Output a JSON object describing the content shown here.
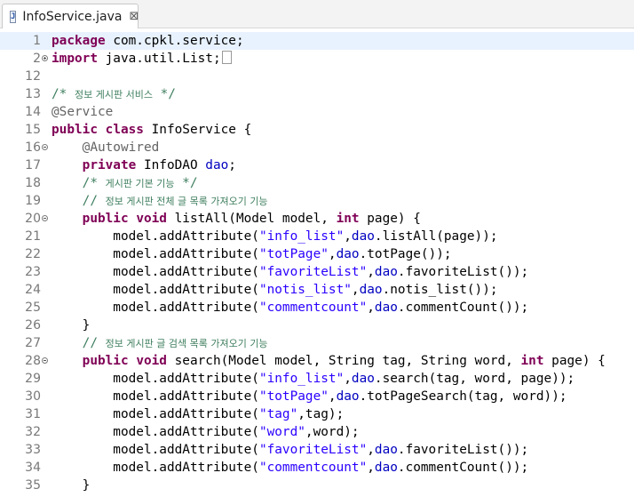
{
  "tab": {
    "icon": "java-file-icon",
    "title": "InfoService.java",
    "close": "⊠"
  },
  "lines": [
    {
      "n": "1",
      "fold": "",
      "current": true,
      "tokens": [
        {
          "t": "package",
          "c": "kw"
        },
        {
          "t": " com.cpkl.service;",
          "c": ""
        }
      ]
    },
    {
      "n": "2",
      "fold": "plus",
      "current": false,
      "tokens": [
        {
          "t": "import",
          "c": "kw"
        },
        {
          "t": " java.util.List;",
          "c": ""
        },
        {
          "t": "",
          "c": "box"
        }
      ]
    },
    {
      "n": "12",
      "fold": "",
      "current": false,
      "tokens": []
    },
    {
      "n": "13",
      "fold": "",
      "current": false,
      "tokens": [
        {
          "t": "/* ",
          "c": "cmt"
        },
        {
          "t": "정보 게시판 서비스",
          "c": "cmt kor"
        },
        {
          "t": " */",
          "c": "cmt"
        }
      ]
    },
    {
      "n": "14",
      "fold": "",
      "current": false,
      "tokens": [
        {
          "t": "@Service",
          "c": "ann"
        }
      ]
    },
    {
      "n": "15",
      "fold": "",
      "current": false,
      "tokens": [
        {
          "t": "public",
          "c": "kw"
        },
        {
          "t": " ",
          "c": ""
        },
        {
          "t": "class",
          "c": "kw"
        },
        {
          "t": " InfoService {",
          "c": ""
        }
      ]
    },
    {
      "n": "16",
      "fold": "minus",
      "current": false,
      "tokens": [
        {
          "t": "    @Autowired",
          "c": "ann"
        }
      ]
    },
    {
      "n": "17",
      "fold": "",
      "current": false,
      "tokens": [
        {
          "t": "    ",
          "c": ""
        },
        {
          "t": "private",
          "c": "kw"
        },
        {
          "t": " InfoDAO ",
          "c": ""
        },
        {
          "t": "dao",
          "c": "fld"
        },
        {
          "t": ";",
          "c": ""
        }
      ]
    },
    {
      "n": "18",
      "fold": "",
      "current": false,
      "tokens": [
        {
          "t": "    /* ",
          "c": "cmt"
        },
        {
          "t": "게시판 기본 기능",
          "c": "cmt kor"
        },
        {
          "t": " */",
          "c": "cmt"
        }
      ]
    },
    {
      "n": "19",
      "fold": "",
      "current": false,
      "tokens": [
        {
          "t": "    // ",
          "c": "cmt"
        },
        {
          "t": "정보 게시판 전체 글 목록 가져오기 기능",
          "c": "cmt kor"
        }
      ]
    },
    {
      "n": "20",
      "fold": "minus",
      "current": false,
      "tokens": [
        {
          "t": "    ",
          "c": ""
        },
        {
          "t": "public",
          "c": "kw"
        },
        {
          "t": " ",
          "c": ""
        },
        {
          "t": "void",
          "c": "kw"
        },
        {
          "t": " listAll(Model model, ",
          "c": ""
        },
        {
          "t": "int",
          "c": "kw"
        },
        {
          "t": " page) {",
          "c": ""
        }
      ]
    },
    {
      "n": "21",
      "fold": "",
      "current": false,
      "tokens": [
        {
          "t": "        model.addAttribute(",
          "c": ""
        },
        {
          "t": "\"info_list\"",
          "c": "str"
        },
        {
          "t": ",",
          "c": ""
        },
        {
          "t": "dao",
          "c": "fld"
        },
        {
          "t": ".listAll(page));",
          "c": ""
        }
      ]
    },
    {
      "n": "22",
      "fold": "",
      "current": false,
      "tokens": [
        {
          "t": "        model.addAttribute(",
          "c": ""
        },
        {
          "t": "\"totPage\"",
          "c": "str"
        },
        {
          "t": ",",
          "c": ""
        },
        {
          "t": "dao",
          "c": "fld"
        },
        {
          "t": ".totPage());",
          "c": ""
        }
      ]
    },
    {
      "n": "23",
      "fold": "",
      "current": false,
      "tokens": [
        {
          "t": "        model.addAttribute(",
          "c": ""
        },
        {
          "t": "\"favoriteList\"",
          "c": "str"
        },
        {
          "t": ",",
          "c": ""
        },
        {
          "t": "dao",
          "c": "fld"
        },
        {
          "t": ".favoriteList());",
          "c": ""
        }
      ]
    },
    {
      "n": "24",
      "fold": "",
      "current": false,
      "tokens": [
        {
          "t": "        model.addAttribute(",
          "c": ""
        },
        {
          "t": "\"notis_list\"",
          "c": "str"
        },
        {
          "t": ",",
          "c": ""
        },
        {
          "t": "dao",
          "c": "fld"
        },
        {
          "t": ".notis_list());",
          "c": ""
        }
      ]
    },
    {
      "n": "25",
      "fold": "",
      "current": false,
      "tokens": [
        {
          "t": "        model.addAttribute(",
          "c": ""
        },
        {
          "t": "\"commentcount\"",
          "c": "str"
        },
        {
          "t": ",",
          "c": ""
        },
        {
          "t": "dao",
          "c": "fld"
        },
        {
          "t": ".commentCount());",
          "c": ""
        }
      ]
    },
    {
      "n": "26",
      "fold": "",
      "current": false,
      "tokens": [
        {
          "t": "    }",
          "c": ""
        }
      ]
    },
    {
      "n": "27",
      "fold": "",
      "current": false,
      "tokens": [
        {
          "t": "    // ",
          "c": "cmt"
        },
        {
          "t": "정보 게시판 글 검색 목록 가져오기 기능",
          "c": "cmt kor"
        }
      ]
    },
    {
      "n": "28",
      "fold": "minus",
      "current": false,
      "tokens": [
        {
          "t": "    ",
          "c": ""
        },
        {
          "t": "public",
          "c": "kw"
        },
        {
          "t": " ",
          "c": ""
        },
        {
          "t": "void",
          "c": "kw"
        },
        {
          "t": " search(Model model, String tag, String word, ",
          "c": ""
        },
        {
          "t": "int",
          "c": "kw"
        },
        {
          "t": " page) {",
          "c": ""
        }
      ]
    },
    {
      "n": "29",
      "fold": "",
      "current": false,
      "tokens": [
        {
          "t": "        model.addAttribute(",
          "c": ""
        },
        {
          "t": "\"info_list\"",
          "c": "str"
        },
        {
          "t": ",",
          "c": ""
        },
        {
          "t": "dao",
          "c": "fld"
        },
        {
          "t": ".search(tag, word, page));",
          "c": ""
        }
      ]
    },
    {
      "n": "30",
      "fold": "",
      "current": false,
      "tokens": [
        {
          "t": "        model.addAttribute(",
          "c": ""
        },
        {
          "t": "\"totPage\"",
          "c": "str"
        },
        {
          "t": ",",
          "c": ""
        },
        {
          "t": "dao",
          "c": "fld"
        },
        {
          "t": ".totPageSearch(tag, word));",
          "c": ""
        }
      ]
    },
    {
      "n": "31",
      "fold": "",
      "current": false,
      "tokens": [
        {
          "t": "        model.addAttribute(",
          "c": ""
        },
        {
          "t": "\"tag\"",
          "c": "str"
        },
        {
          "t": ",tag);",
          "c": ""
        }
      ]
    },
    {
      "n": "32",
      "fold": "",
      "current": false,
      "tokens": [
        {
          "t": "        model.addAttribute(",
          "c": ""
        },
        {
          "t": "\"word\"",
          "c": "str"
        },
        {
          "t": ",word);",
          "c": ""
        }
      ]
    },
    {
      "n": "33",
      "fold": "",
      "current": false,
      "tokens": [
        {
          "t": "        model.addAttribute(",
          "c": ""
        },
        {
          "t": "\"favoriteList\"",
          "c": "str"
        },
        {
          "t": ",",
          "c": ""
        },
        {
          "t": "dao",
          "c": "fld"
        },
        {
          "t": ".favoriteList());",
          "c": ""
        }
      ]
    },
    {
      "n": "34",
      "fold": "",
      "current": false,
      "tokens": [
        {
          "t": "        model.addAttribute(",
          "c": ""
        },
        {
          "t": "\"commentcount\"",
          "c": "str"
        },
        {
          "t": ",",
          "c": ""
        },
        {
          "t": "dao",
          "c": "fld"
        },
        {
          "t": ".commentCount());",
          "c": ""
        }
      ]
    },
    {
      "n": "35",
      "fold": "",
      "current": false,
      "tokens": [
        {
          "t": "    }",
          "c": ""
        }
      ]
    }
  ]
}
